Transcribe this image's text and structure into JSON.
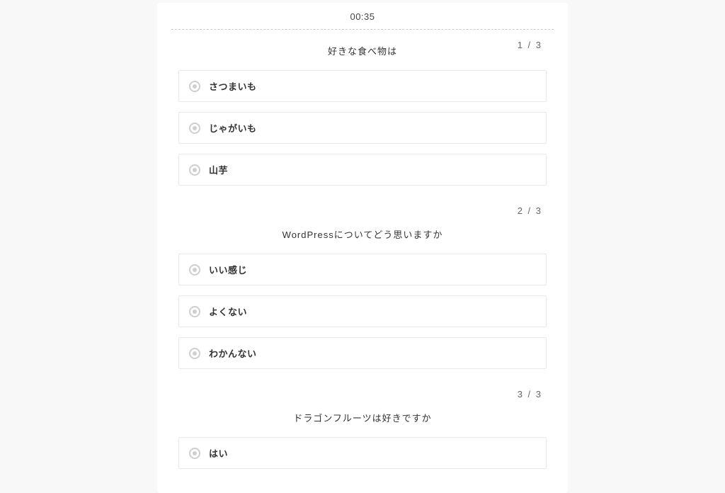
{
  "timer": "00:35",
  "questions": [
    {
      "counter": "1 / 3",
      "title": "好きな食べ物は",
      "options": [
        "さつまいも",
        "じゃがいも",
        "山芋"
      ]
    },
    {
      "counter": "2 / 3",
      "title": "WordPressについてどう思いますか",
      "options": [
        "いい感じ",
        "よくない",
        "わかんない"
      ]
    },
    {
      "counter": "3 / 3",
      "title": "ドラゴンフルーツは好きですか",
      "options": [
        "はい"
      ]
    }
  ]
}
